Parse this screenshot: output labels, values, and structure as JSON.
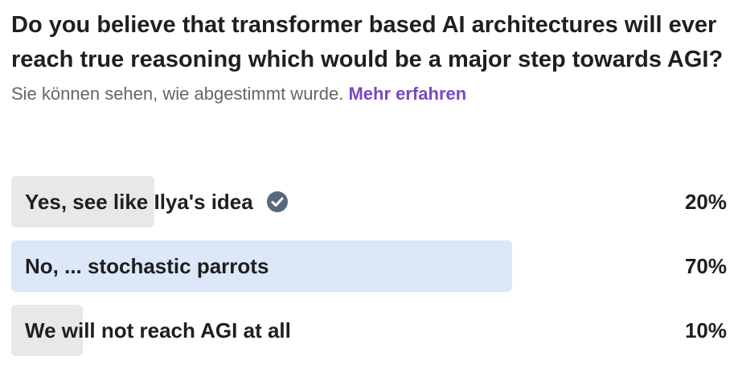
{
  "poll": {
    "question": "Do you believe that transformer based AI architectures will ever reach true reasoning which would be a major step towards AGI?",
    "visibility_note": "Sie können sehen, wie abgestimmt wurde.",
    "learn_more": "Mehr erfahren",
    "colors": {
      "learn_more": "#7a47c6",
      "bar_default": "#e8e8e8",
      "bar_leading": "#dce7f7",
      "check_icon": "#56687a"
    },
    "options": [
      {
        "label": "Yes, see like Ilya's idea",
        "percent_text": "20%",
        "percent": 20,
        "selected": true,
        "leading": false
      },
      {
        "label": "No, ... stochastic parrots",
        "percent_text": "70%",
        "percent": 70,
        "selected": false,
        "leading": true
      },
      {
        "label": "We will not reach AGI at all",
        "percent_text": "10%",
        "percent": 10,
        "selected": false,
        "leading": false
      }
    ]
  }
}
